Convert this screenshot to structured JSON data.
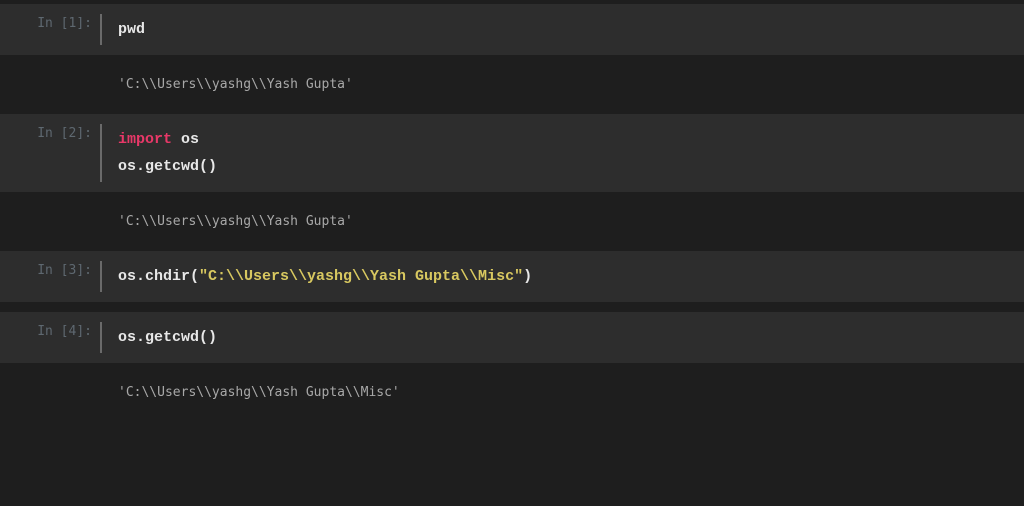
{
  "cells": [
    {
      "prompt": "In [1]:",
      "code_lines": [
        {
          "segments": [
            {
              "text": "pwd",
              "class": "code-line"
            }
          ]
        }
      ],
      "output": "'C:\\\\Users\\\\yashg\\\\Yash Gupta'"
    },
    {
      "prompt": "In [2]:",
      "code_lines": [
        {
          "segments": [
            {
              "text": "import",
              "class": "keyword"
            },
            {
              "text": " os",
              "class": "module"
            }
          ]
        },
        {
          "segments": [
            {
              "text": "os.getcwd()",
              "class": "method"
            }
          ]
        }
      ],
      "output": "'C:\\\\Users\\\\yashg\\\\Yash Gupta'"
    },
    {
      "prompt": "In [3]:",
      "code_lines": [
        {
          "segments": [
            {
              "text": "os.chdir(",
              "class": "method"
            },
            {
              "text": "\"C:\\\\Users\\\\yashg\\\\Yash Gupta\\\\Misc\"",
              "class": "string"
            },
            {
              "text": ")",
              "class": "paren"
            }
          ]
        }
      ],
      "output": null
    },
    {
      "prompt": "In [4]:",
      "code_lines": [
        {
          "segments": [
            {
              "text": "os.getcwd()",
              "class": "method"
            }
          ]
        }
      ],
      "output": "'C:\\\\Users\\\\yashg\\\\Yash Gupta\\\\Misc'"
    }
  ]
}
